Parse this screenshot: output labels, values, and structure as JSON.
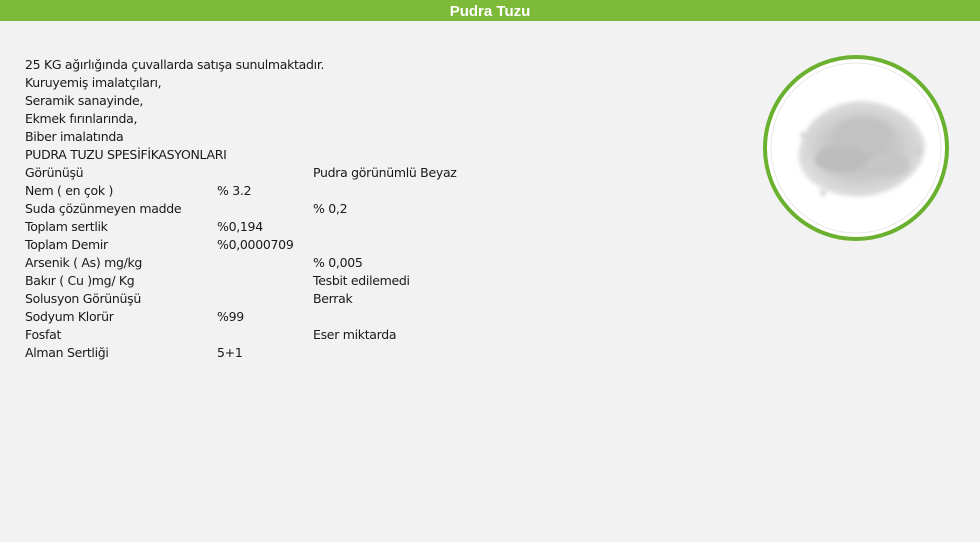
{
  "header": {
    "title": "Pudra Tuzu"
  },
  "intro_lines": [
    "25 KG  ağırlığında çuvallarda satışa sunulmaktadır.",
    "Kuruyemiş imalatçıları,",
    "Seramik sanayinde,",
    "Ekmek fırınlarında,",
    "Biber imalatında",
    "PUDRA TUZU SPESİFİKASYONLARI"
  ],
  "specs": [
    {
      "label": "Görünüşü",
      "value": "Pudra görünümlü Beyaz",
      "column": 2
    },
    {
      "label": "Nem ( en çok )",
      "value": "% 3.2",
      "column": 1
    },
    {
      "label": "Suda çözünmeyen madde",
      "value": "% 0,2",
      "column": 2
    },
    {
      "label": "Toplam sertlik",
      "value": "%0,194",
      "column": 1
    },
    {
      "label": "Toplam  Demir",
      "value": "%0,0000709",
      "column": 1
    },
    {
      "label": "Arsenik ( As) mg/kg",
      "value": "% 0,005",
      "column": 2
    },
    {
      "label": "Bakır ( Cu )mg/ Kg",
      "value": "Tesbit edilemedi",
      "column": 2
    },
    {
      "label": "Solusyon Görünüşü",
      "value": "Berrak",
      "column": 2
    },
    {
      "label": "Sodyum Klorür",
      "value": "%99",
      "column": 1
    },
    {
      "label": "Fosfat",
      "value": "Eser miktarda",
      "column": 2
    },
    {
      "label": "Alman Sertliği",
      "value": "5+1",
      "column": 1
    }
  ],
  "colors": {
    "header_bg": "#7dba3a",
    "ring": "#6ab12f",
    "background": "#f2f2f2"
  },
  "image": {
    "subject": "powder-salt-pile-photo"
  }
}
